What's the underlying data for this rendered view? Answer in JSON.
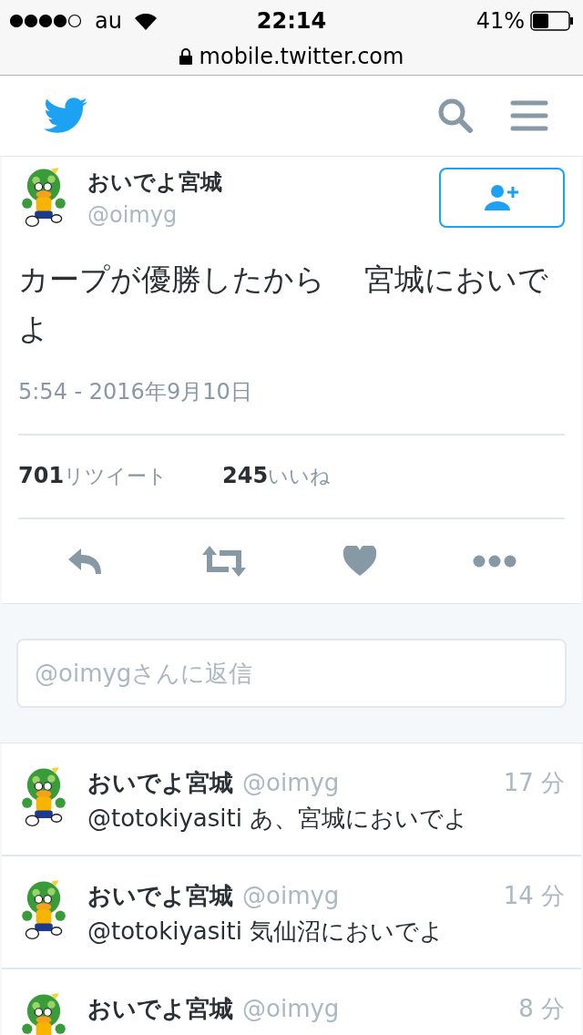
{
  "status_bar": {
    "carrier": "au",
    "time": "22:14",
    "battery": "41%"
  },
  "browser": {
    "url": "mobile.twitter.com"
  },
  "tweet": {
    "name": "おいでよ宮城",
    "handle": "@oimyg",
    "text": "カープが優勝したから　 宮城においでよ",
    "timestamp": "5:54 - 2016年9月10日",
    "stats": [
      {
        "count": "701",
        "label": "リツイート"
      },
      {
        "count": "245",
        "label": "いいね"
      }
    ]
  },
  "reply_box": {
    "placeholder": "@oimygさんに返信"
  },
  "replies": [
    {
      "name": "おいでよ宮城",
      "handle": "@oimyg",
      "time": "17 分",
      "text": "@totokiyasiti あ、宮城においでよ"
    },
    {
      "name": "おいでよ宮城",
      "handle": "@oimyg",
      "time": "14 分",
      "text": "@totokiyasiti 気仙沼においでよ"
    },
    {
      "name": "おいでよ宮城",
      "handle": "@oimyg",
      "time": "8 分"
    }
  ]
}
